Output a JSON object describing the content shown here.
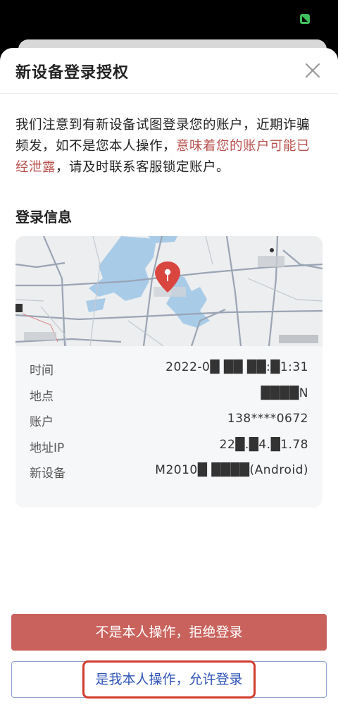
{
  "dialog": {
    "title": "新设备登录授权"
  },
  "notice": {
    "text_before": "我们注意到有新设备试图登录您的账户，近期诈骗频发，如不是您本人操作，",
    "warning": "意味着您的账户可能已经泄露",
    "text_after": "，请及时联系客服锁定账户。"
  },
  "login_info": {
    "section_title": "登录信息",
    "rows": [
      {
        "label": "时间",
        "value": "2022-0█ ██ ██:█1:31"
      },
      {
        "label": "地点",
        "value": "████N"
      },
      {
        "label": "账户",
        "value": "138****0672"
      },
      {
        "label": "地址IP",
        "value": "22█.█4.█1.78"
      },
      {
        "label": "新设备",
        "value": "M2010█ ████(Android)"
      }
    ]
  },
  "actions": {
    "reject_label": "不是本人操作，拒绝登录",
    "allow_label": "是我本人操作，允许登录"
  },
  "colors": {
    "warning": "#b8524e",
    "reject_button": "#c9625d",
    "allow_text": "#2f55b5",
    "highlight": "#d23b30",
    "map_marker": "#d9453f"
  },
  "icons": {
    "close": "close-icon",
    "map_marker": "location-pin-icon"
  }
}
